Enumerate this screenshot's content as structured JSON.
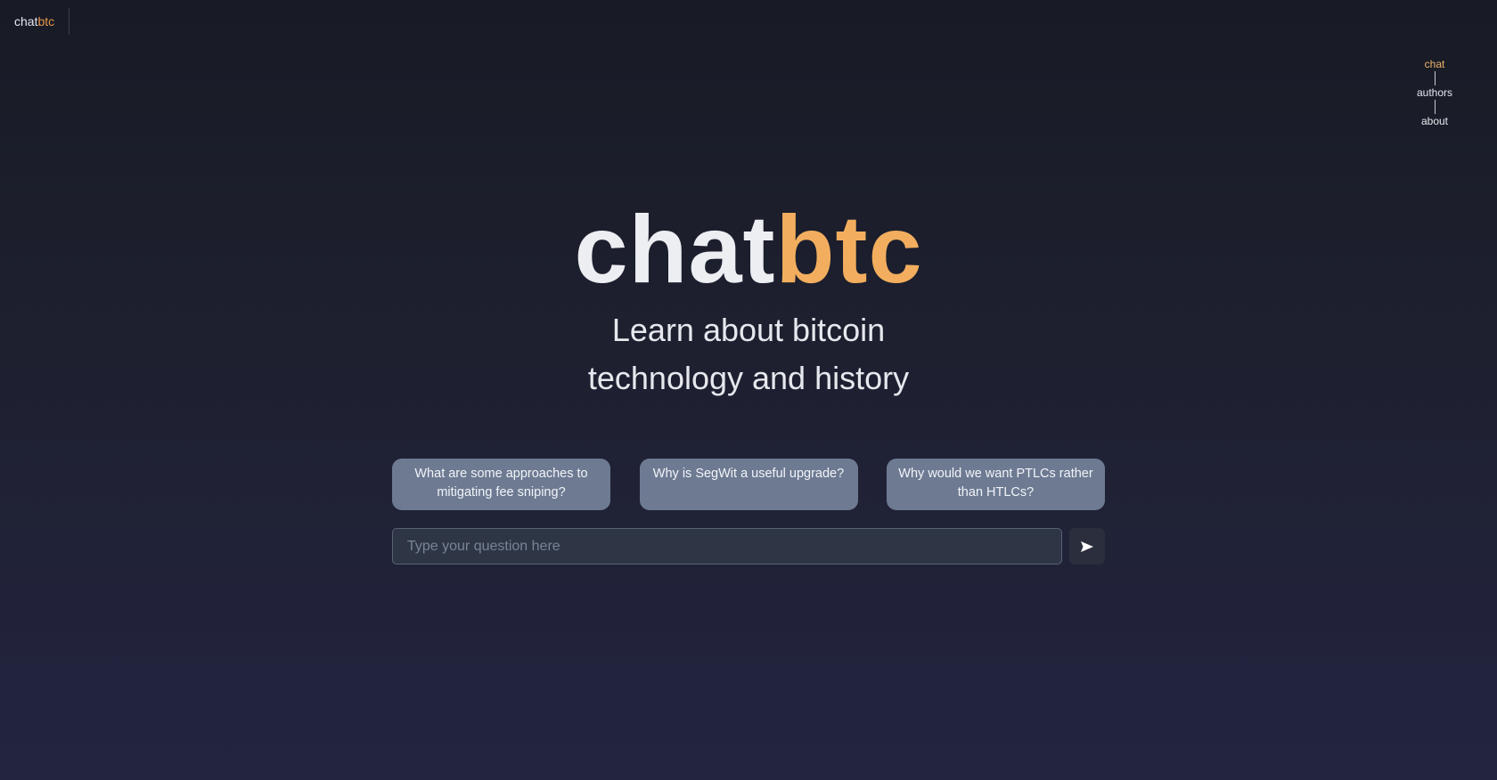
{
  "header": {
    "logo_chat": "chat",
    "logo_btc": "btc"
  },
  "nav": {
    "items": [
      {
        "label": "chat",
        "active": true
      },
      {
        "label": "authors",
        "active": false
      },
      {
        "label": "about",
        "active": false
      }
    ]
  },
  "hero": {
    "title_chat": "chat",
    "title_btc": "btc",
    "subtitle_line1": "Learn about bitcoin",
    "subtitle_line2": "technology and history"
  },
  "suggestions": [
    "What are some approaches to mitigating fee sniping?",
    "Why is SegWit a useful upgrade?",
    "Why would we want PTLCs rather than HTLCs?"
  ],
  "question": {
    "placeholder": "Type your question here",
    "value": ""
  },
  "send": {
    "icon": "send-icon"
  },
  "colors": {
    "accent": "#f2ae5e",
    "active_nav": "#f0b46a",
    "suggestion_bg": "#6d7a92",
    "input_bg": "#2e3646"
  }
}
